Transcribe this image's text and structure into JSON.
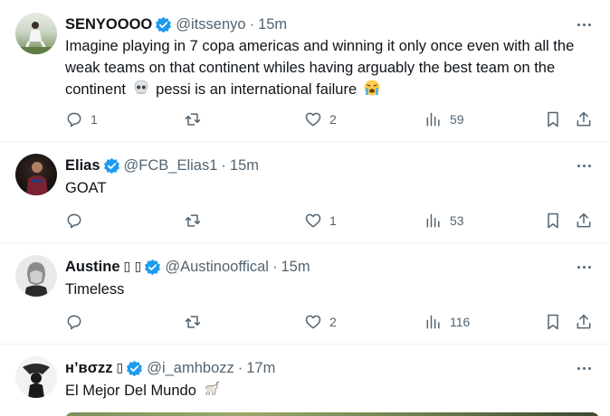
{
  "tweets": [
    {
      "name": "SENYOOOO",
      "name_suffix": "",
      "handle": "@itssenyo",
      "time": "15m",
      "text_1": "Imagine playing in 7 copa americas and winning it only once even with all the weak teams on that continent whiles having arguably the best team on the continent",
      "text_emoji_1": "skull-emoji",
      "text_2": "pessi is an international failure",
      "text_emoji_2": "crying-face-emoji",
      "replies": "1",
      "reposts": "",
      "likes": "2",
      "views": "59"
    },
    {
      "name": "Elias",
      "name_suffix": "",
      "handle": "@FCB_Elias1",
      "time": "15m",
      "text_1": "GOAT",
      "replies": "",
      "reposts": "",
      "likes": "1",
      "views": "53"
    },
    {
      "name": "Austine",
      "name_suffix": "▯ ▯",
      "handle": "@Austinooffical",
      "time": "15m",
      "text_1": "Timeless",
      "replies": "",
      "reposts": "",
      "likes": "2",
      "views": "116"
    },
    {
      "name": "ʜ’вσzz",
      "name_suffix": "▯",
      "handle": "@i_amhbozz",
      "time": "17m",
      "text_1": "El Mejor Del Mundo",
      "text_emoji_1": "goat-emoji"
    }
  ],
  "colors": {
    "verified": "#1d9bf0",
    "secondary_text": "#536471",
    "primary_text": "#0f1419",
    "divider": "#eff3f4"
  },
  "icons": {
    "reply": "reply-icon",
    "repost": "repost-icon",
    "like": "like-icon",
    "views": "views-icon",
    "bookmark": "bookmark-icon",
    "share": "share-icon",
    "more": "more-icon"
  }
}
